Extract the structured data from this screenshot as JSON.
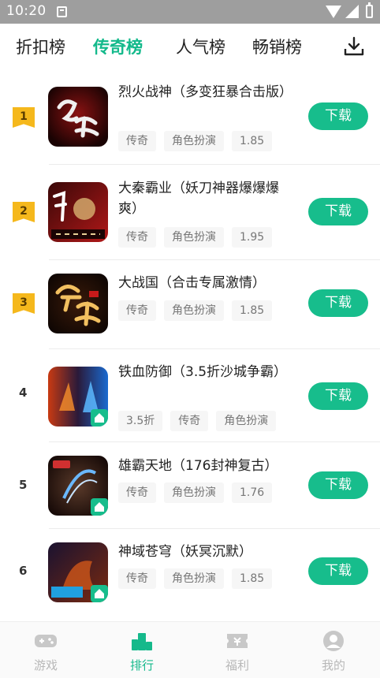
{
  "status_bar": {
    "time": "10:20"
  },
  "tabs": [
    {
      "label": "折扣榜",
      "active": false
    },
    {
      "label": "传奇榜",
      "active": true
    },
    {
      "label": "人气榜",
      "active": false
    },
    {
      "label": "畅销榜",
      "active": false
    }
  ],
  "download_icon": "download-icon",
  "games": [
    {
      "rank": "1",
      "title": "烈火战神（多变狂暴合击版）",
      "tags": [
        "传奇",
        "角色扮演",
        "1.85"
      ],
      "button": "下载"
    },
    {
      "rank": "2",
      "title": "大秦霸业（妖刀神器爆爆爆爽）",
      "tags": [
        "传奇",
        "角色扮演",
        "1.95"
      ],
      "button": "下载"
    },
    {
      "rank": "3",
      "title": "大战国（合击专属激情）",
      "tags": [
        "传奇",
        "角色扮演",
        "1.85"
      ],
      "button": "下载"
    },
    {
      "rank": "4",
      "title": "铁血防御（3.5折沙城争霸）",
      "tags": [
        "3.5折",
        "传奇",
        "角色扮演"
      ],
      "button": "下载"
    },
    {
      "rank": "5",
      "title": "雄霸天地（176封神复古）",
      "tags": [
        "传奇",
        "角色扮演",
        "1.76"
      ],
      "button": "下载"
    },
    {
      "rank": "6",
      "title": "神域苍穹（妖冥沉默）",
      "tags": [
        "传奇",
        "角色扮演",
        "1.85"
      ],
      "button": "下载"
    }
  ],
  "bottom_nav": [
    {
      "label": "游戏",
      "icon": "gamepad-icon",
      "active": false
    },
    {
      "label": "排行",
      "icon": "ranking-icon",
      "active": true
    },
    {
      "label": "福利",
      "icon": "ticket-icon",
      "active": false
    },
    {
      "label": "我的",
      "icon": "profile-icon",
      "active": false
    }
  ],
  "colors": {
    "accent": "#17bd8c",
    "rank_badge": "#f5b81c",
    "tag_bg": "#f6f6f6"
  }
}
